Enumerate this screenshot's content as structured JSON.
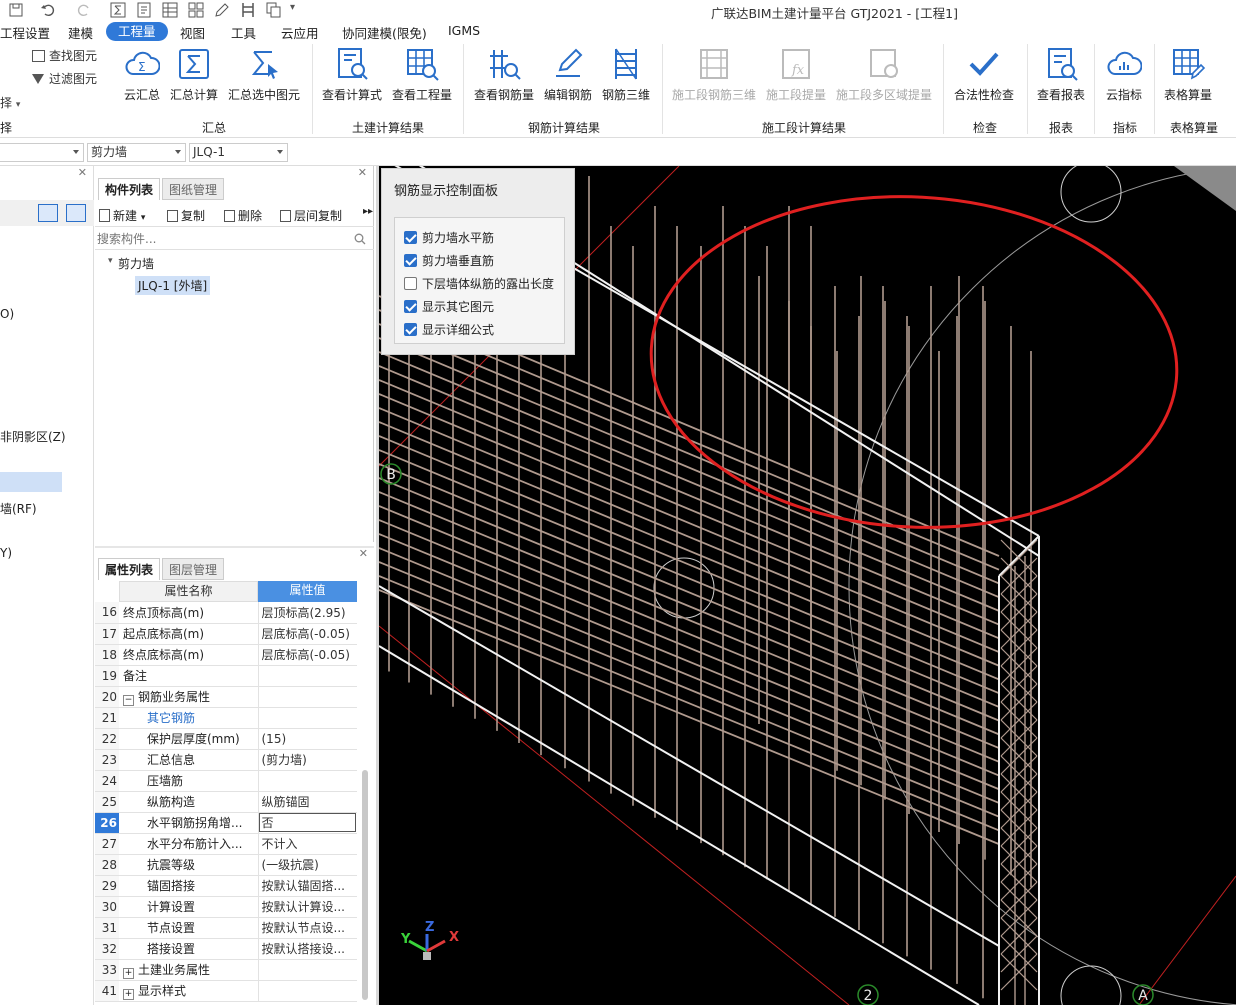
{
  "app": {
    "title": "广联达BIM土建计量平台 GTJ2021 - [工程1]"
  },
  "menu": {
    "items": [
      "工程设置",
      "建模",
      "工程量",
      "视图",
      "工具",
      "云应用",
      "协同建模(限免)",
      "IGMS"
    ],
    "active_index": 2
  },
  "ribbon": {
    "left_items": [
      "查找图元",
      "过滤图元",
      "择"
    ],
    "buttons": [
      "云汇总",
      "汇总计算",
      "汇总选中图元",
      "查看计算式",
      "查看工程量",
      "查看钢筋量",
      "编辑钢筋",
      "钢筋三维",
      "施工段钢筋三维",
      "施工段提量",
      "施工段多区域提量",
      "合法性检查",
      "查看报表",
      "云指标",
      "表格算量"
    ],
    "groups": [
      "择",
      "汇总",
      "土建计算结果",
      "钢筋计算结果",
      "施工段计算结果",
      "检查",
      "报表",
      "指标",
      "表格算量"
    ]
  },
  "combos": [
    "剪力墙",
    "JLQ-1"
  ],
  "left_strip": [
    "O)",
    "非阴影区(Z)",
    "墙(RF)",
    "Y)"
  ],
  "component_panel": {
    "tabs": [
      "构件列表",
      "图纸管理"
    ],
    "toolbar": [
      "新建",
      "复制",
      "删除",
      "层间复制"
    ],
    "search_placeholder": "搜索构件...",
    "tree_root": "剪力墙",
    "tree_item": "JLQ-1 [外墙]"
  },
  "properties": {
    "tabs": [
      "属性列表",
      "图层管理"
    ],
    "header_name": "属性名称",
    "header_value": "属性值",
    "rows": [
      {
        "no": "16",
        "name": "终点顶标高(m)",
        "value": "层顶标高(2.95)"
      },
      {
        "no": "17",
        "name": "起点底标高(m)",
        "value": "层底标高(-0.05)"
      },
      {
        "no": "18",
        "name": "终点底标高(m)",
        "value": "层底标高(-0.05)"
      },
      {
        "no": "19",
        "name": "备注",
        "value": ""
      },
      {
        "no": "20",
        "name": "钢筋业务属性",
        "value": ""
      },
      {
        "no": "21",
        "name": "其它钢筋",
        "value": ""
      },
      {
        "no": "22",
        "name": "保护层厚度(mm)",
        "value": "(15)"
      },
      {
        "no": "23",
        "name": "汇总信息",
        "value": "(剪力墙)"
      },
      {
        "no": "24",
        "name": "压墙筋",
        "value": ""
      },
      {
        "no": "25",
        "name": "纵筋构造",
        "value": "纵筋锚固"
      },
      {
        "no": "26",
        "name": "水平钢筋拐角增...",
        "value": "否"
      },
      {
        "no": "27",
        "name": "水平分布筋计入...",
        "value": "不计入"
      },
      {
        "no": "28",
        "name": "抗震等级",
        "value": "(一级抗震)"
      },
      {
        "no": "29",
        "name": "锚固搭接",
        "value": "按默认锚固搭..."
      },
      {
        "no": "30",
        "name": "计算设置",
        "value": "按默认计算设..."
      },
      {
        "no": "31",
        "name": "节点设置",
        "value": "按默认节点设..."
      },
      {
        "no": "32",
        "name": "搭接设置",
        "value": "按默认搭接设..."
      },
      {
        "no": "33",
        "name": "土建业务属性",
        "value": ""
      },
      {
        "no": "41",
        "name": "显示样式",
        "value": ""
      }
    ],
    "selected_no": "26"
  },
  "rebar_panel": {
    "title": "钢筋显示控制面板",
    "options": [
      {
        "label": "剪力墙水平筋",
        "checked": true
      },
      {
        "label": "剪力墙垂直筋",
        "checked": true
      },
      {
        "label": "下层墙体纵筋的露出长度",
        "checked": false
      },
      {
        "label": "显示其它图元",
        "checked": true
      },
      {
        "label": "显示详细公式",
        "checked": true
      }
    ]
  },
  "viewport": {
    "axis_labels": [
      "B",
      "2",
      "A"
    ],
    "gizmo_labels": [
      "Y",
      "Z",
      "X"
    ],
    "highlight_color": "#e02020"
  }
}
